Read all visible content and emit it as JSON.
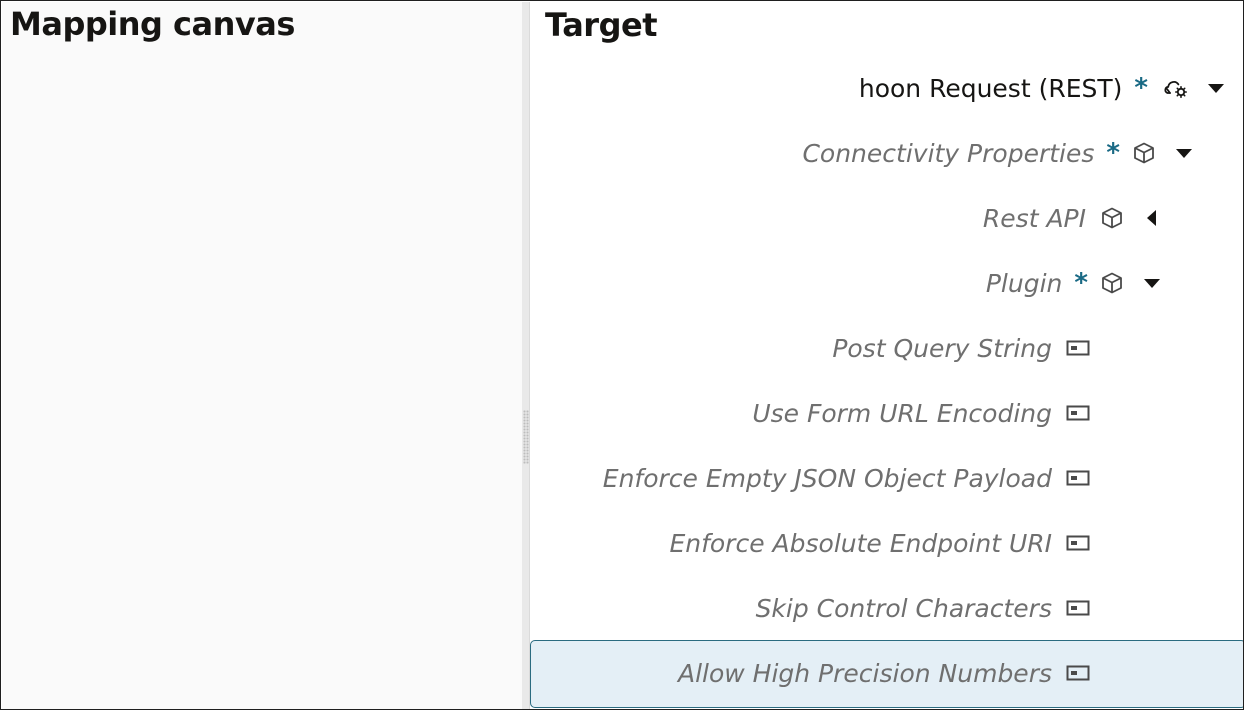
{
  "left_pane": {
    "title": "Mapping canvas"
  },
  "right_pane": {
    "title": "Target",
    "tree": [
      {
        "label": "hoon Request (REST)",
        "required": "*",
        "icon": "cloud-gear-icon",
        "toggle": "expanded"
      },
      {
        "label": "Connectivity Properties",
        "required": "*",
        "icon": "cube-icon",
        "toggle": "expanded"
      },
      {
        "label": "Rest API",
        "required": "",
        "icon": "cube-icon",
        "toggle": "collapsed"
      },
      {
        "label": "Plugin",
        "required": "*",
        "icon": "cube-icon",
        "toggle": "expanded"
      },
      {
        "label": "Post Query String",
        "required": "",
        "icon": "field-icon",
        "toggle": "none"
      },
      {
        "label": "Use Form URL Encoding",
        "required": "",
        "icon": "field-icon",
        "toggle": "none"
      },
      {
        "label": "Enforce Empty JSON Object Payload",
        "required": "",
        "icon": "field-icon",
        "toggle": "none"
      },
      {
        "label": "Enforce Absolute Endpoint URI",
        "required": "",
        "icon": "field-icon",
        "toggle": "none"
      },
      {
        "label": "Skip Control Characters",
        "required": "",
        "icon": "field-icon",
        "toggle": "none"
      },
      {
        "label": "Allow High Precision Numbers",
        "required": "",
        "icon": "field-icon",
        "toggle": "none",
        "selected": true
      }
    ]
  },
  "colors": {
    "required_marker": "#1a6a85",
    "selected_bg": "#e4eff6",
    "selected_border": "#2a6b80",
    "label_muted": "#6f6f6f"
  }
}
